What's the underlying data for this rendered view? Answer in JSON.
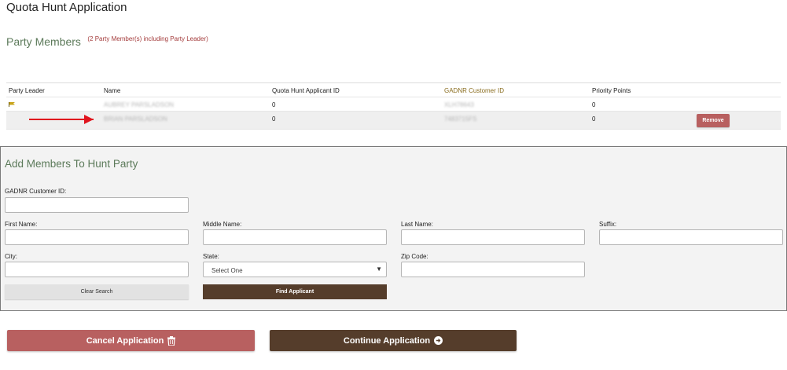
{
  "page": {
    "title": "Quota Hunt Application"
  },
  "party": {
    "heading": "Party Members",
    "count_note": "(2 Party Member(s) including Party Leader)",
    "columns": [
      "Party Leader",
      "Name",
      "Quota Hunt Applicant ID",
      "GADNR Customer ID",
      "Priority Points"
    ],
    "rows": [
      {
        "name": "AUBREY PARSLADSON",
        "applicant_id": "0",
        "customer_id": "XLH78643",
        "points": "0",
        "leader": true
      },
      {
        "name": "BRIAN PARSLADSON",
        "applicant_id": "0",
        "customer_id": "7483715FS",
        "points": "0",
        "leader": false,
        "remove_label": "Remove"
      }
    ]
  },
  "add_members": {
    "title": "Add Members To Hunt Party",
    "labels": {
      "customer_id": "GADNR Customer ID:",
      "first_name": "First Name:",
      "middle_name": "Middle Name:",
      "last_name": "Last Name:",
      "suffix": "Suffix:",
      "city": "City:",
      "state": "State:",
      "zip": "Zip Code:"
    },
    "state_value": "Select One",
    "clear_label": "Clear Search",
    "find_label": "Find Applicant"
  },
  "actions": {
    "cancel_label": "Cancel Application",
    "continue_label": "Continue Application"
  },
  "colors": {
    "accent_green": "#5c7a5a",
    "cancel_red": "#b86060",
    "brown": "#553d2b",
    "annotation_arrow": "#e0141e"
  }
}
